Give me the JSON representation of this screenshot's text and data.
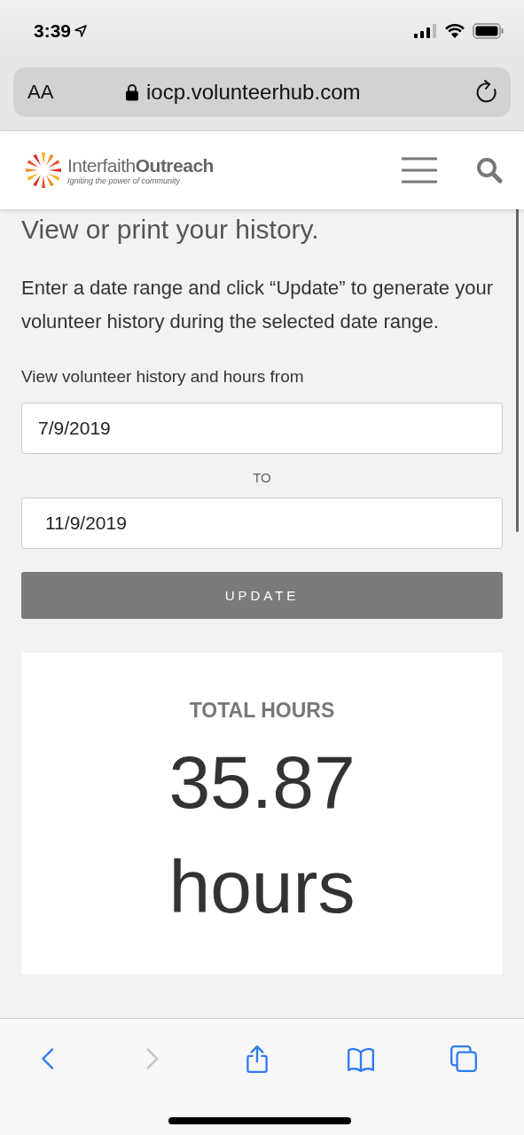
{
  "status_bar": {
    "time": "3:39"
  },
  "address_bar": {
    "text_size": "AA",
    "url": "iocp.volunteerhub.com"
  },
  "site_header": {
    "logo_name": "Interfaith**Outreach**",
    "tagline": "Igniting the power of community"
  },
  "content": {
    "heading": "View or print your history.",
    "intro": "Enter a date range and click “Update” to generate your volunteer history during the selected date range.",
    "range_label": "View volunteer history and hours from",
    "from_field": {
      "value": "7/9/2019"
    },
    "separator": "TO",
    "to_field": {
      "value": "11/9/2019"
    },
    "update_button": "UPDATE",
    "summary": {
      "title": "TOTAL HOURS",
      "value": "35.87",
      "unit": "hours"
    }
  },
  "toolbar": [
    {
      "kind": "back",
      "disabled": false
    },
    {
      "kind": "forward",
      "disabled": true
    },
    {
      "kind": "share",
      "disabled": false
    },
    {
      "kind": "bookmarks",
      "disabled": false
    },
    {
      "kind": "tabs",
      "disabled": false
    }
  ]
}
